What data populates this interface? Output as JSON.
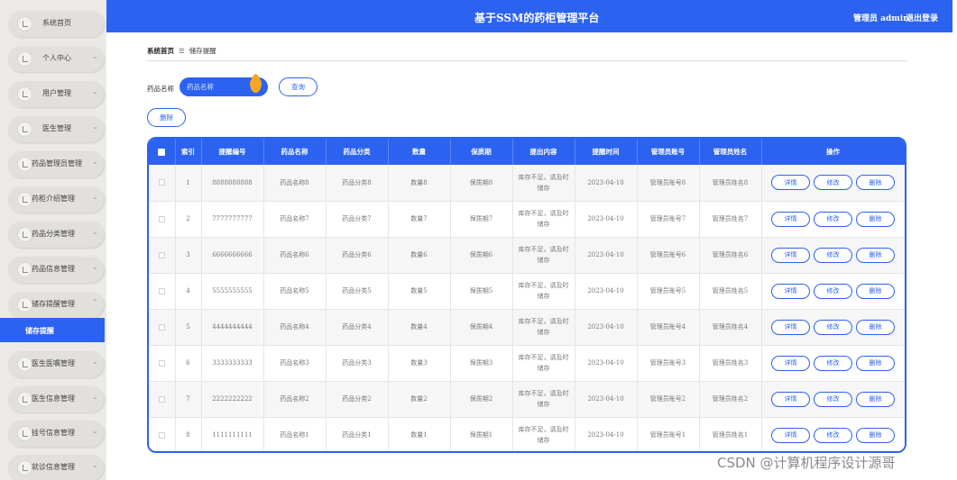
{
  "header": {
    "title": "基于SSM的药柜管理平台",
    "user_label": "管理员 admin",
    "logout_label": "退出登录"
  },
  "sidebar": {
    "items": [
      {
        "label": "系统首页",
        "chevron": false
      },
      {
        "label": "个人中心",
        "chevron": true
      },
      {
        "label": "用户管理",
        "chevron": true
      },
      {
        "label": "医生管理",
        "chevron": true
      },
      {
        "label": "药品管理员管理",
        "chevron": true
      },
      {
        "label": "药柜介绍管理",
        "chevron": true
      },
      {
        "label": "药品分类管理",
        "chevron": true
      },
      {
        "label": "药品信息管理",
        "chevron": true
      },
      {
        "label": "储存提醒管理",
        "chevron": true,
        "expanded": true
      },
      {
        "label": "医生医嘱管理",
        "chevron": true
      },
      {
        "label": "医生信息管理",
        "chevron": true
      },
      {
        "label": "挂号信息管理",
        "chevron": true
      },
      {
        "label": "就诊信息管理",
        "chevron": true
      }
    ],
    "active_sub_item": "储存提醒"
  },
  "breadcrumb": {
    "home": "系统首页",
    "separator": "☰",
    "current": "储存提醒"
  },
  "search": {
    "label": "药品名称",
    "placeholder": "药品名称",
    "query_button": "查询"
  },
  "toolbar": {
    "delete_label": "删除"
  },
  "table": {
    "columns": [
      "索引",
      "提醒编号",
      "药品名称",
      "药品分类",
      "数量",
      "保质期",
      "提出内容",
      "提醒时间",
      "管理员账号",
      "管理员姓名",
      "操作"
    ],
    "actions": [
      "详情",
      "修改",
      "删除"
    ],
    "rows": [
      {
        "index": "1",
        "code": "8888888888",
        "name": "药品名称8",
        "category": "药品分类8",
        "qty": "数量8",
        "shelf": "保质期8",
        "content": "库存不足，请及时储存",
        "time": "2023-04-10",
        "account": "管理员账号8",
        "admin": "管理员姓名8"
      },
      {
        "index": "2",
        "code": "7777777777",
        "name": "药品名称7",
        "category": "药品分类7",
        "qty": "数量7",
        "shelf": "保质期7",
        "content": "库存不足，请及时储存",
        "time": "2023-04-10",
        "account": "管理员账号7",
        "admin": "管理员姓名7"
      },
      {
        "index": "3",
        "code": "6666666666",
        "name": "药品名称6",
        "category": "药品分类6",
        "qty": "数量6",
        "shelf": "保质期6",
        "content": "库存不足，请及时储存",
        "time": "2023-04-10",
        "account": "管理员账号6",
        "admin": "管理员姓名6"
      },
      {
        "index": "4",
        "code": "5555555555",
        "name": "药品名称5",
        "category": "药品分类5",
        "qty": "数量5",
        "shelf": "保质期5",
        "content": "库存不足，请及时储存",
        "time": "2023-04-10",
        "account": "管理员账号5",
        "admin": "管理员姓名5"
      },
      {
        "index": "5",
        "code": "4444444444",
        "name": "药品名称4",
        "category": "药品分类4",
        "qty": "数量4",
        "shelf": "保质期4",
        "content": "库存不足，请及时储存",
        "time": "2023-04-10",
        "account": "管理员账号4",
        "admin": "管理员姓名4"
      },
      {
        "index": "6",
        "code": "3333333333",
        "name": "药品名称3",
        "category": "药品分类3",
        "qty": "数量3",
        "shelf": "保质期3",
        "content": "库存不足，请及时储存",
        "time": "2023-04-10",
        "account": "管理员账号3",
        "admin": "管理员姓名3"
      },
      {
        "index": "7",
        "code": "2222222222",
        "name": "药品名称2",
        "category": "药品分类2",
        "qty": "数量2",
        "shelf": "保质期2",
        "content": "库存不足，请及时储存",
        "time": "2023-04-10",
        "account": "管理员账号2",
        "admin": "管理员姓名2"
      },
      {
        "index": "8",
        "code": "1111111111",
        "name": "药品名称1",
        "category": "药品分类1",
        "qty": "数量1",
        "shelf": "保质期1",
        "content": "库存不足，请及时储存",
        "time": "2023-04-10",
        "account": "管理员账号1",
        "admin": "管理员姓名1"
      }
    ]
  },
  "watermark": "CSDN @计算机程序设计源哥",
  "colors": {
    "primary": "#2b62f0",
    "sidebar_bg": "#eceae6",
    "accent_drop": "#f5a623"
  }
}
